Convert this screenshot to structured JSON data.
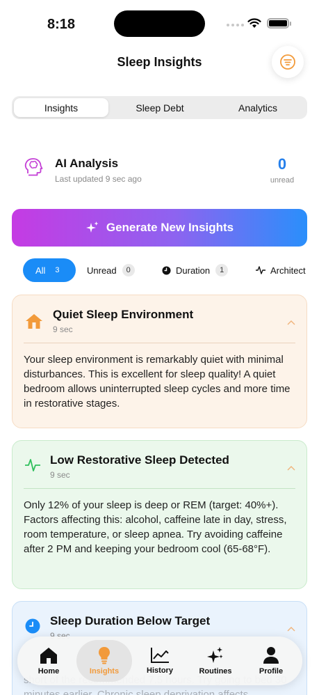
{
  "status": {
    "time": "8:18"
  },
  "header": {
    "title": "Sleep Insights",
    "filter_icon": "filter-lines-icon"
  },
  "segments": [
    {
      "label": "Insights",
      "active": true
    },
    {
      "label": "Sleep Debt",
      "active": false
    },
    {
      "label": "Analytics",
      "active": false
    }
  ],
  "analysis": {
    "title": "AI Analysis",
    "updated": "Last updated 9 sec ago",
    "count": "0",
    "count_label": "unread"
  },
  "generate": {
    "label": "Generate New Insights"
  },
  "filters": [
    {
      "label": "All",
      "count": "3",
      "active": true
    },
    {
      "label": "Unread",
      "count": "0"
    },
    {
      "label": "Duration",
      "count": "1"
    },
    {
      "label": "Architect"
    }
  ],
  "insights": [
    {
      "title": "Quiet Sleep Environment",
      "time": "9 sec",
      "body": "Your sleep environment is remarkably quiet with minimal disturbances. This is excellent for sleep quality! A quiet bedroom allows uninterrupted sleep cycles and more time in restorative stages.",
      "icon": "house-icon"
    },
    {
      "title": "Low Restorative Sleep Detected",
      "time": "9 sec",
      "body": "Only 12% of your sleep is deep or REM (target: 40%+). Factors affecting this: alcohol, caffeine late in day, stress, room temperature, or sleep apnea. Try avoiding caffeine after 2 PM and keeping your bedroom cool (65-68°F).",
      "icon": "waveform-icon"
    },
    {
      "title": "Sleep Duration Below Target",
      "time": "9 sec",
      "body": "short of the recommended 7.5 hours. Try going to bed 30 minutes earlier. Chronic sleep deprivation affects",
      "icon": "clock-icon"
    }
  ],
  "colors": {
    "accent_blue": "#1a8cf7",
    "accent_orange": "#f29a3a",
    "card_orange_bg": "#fdf3e9",
    "card_green_bg": "#ebf8ec",
    "card_blue_bg": "#eaf3fd"
  },
  "tabbar": [
    {
      "label": "Home",
      "icon": "home-icon"
    },
    {
      "label": "Insights",
      "icon": "lightbulb-icon",
      "active": true
    },
    {
      "label": "History",
      "icon": "chart-line-icon"
    },
    {
      "label": "Routines",
      "icon": "sparkles-icon"
    },
    {
      "label": "Profile",
      "icon": "person-icon"
    }
  ]
}
